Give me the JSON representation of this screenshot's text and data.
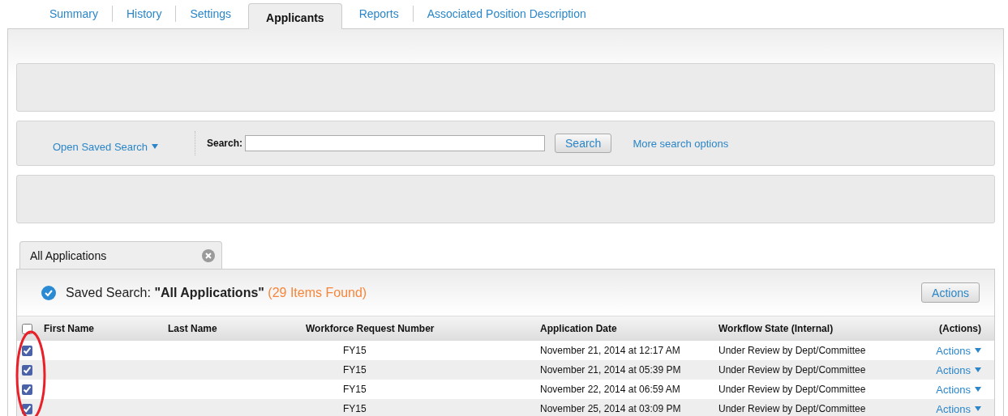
{
  "tabs": [
    {
      "label": "Summary",
      "selected": false
    },
    {
      "label": "History",
      "selected": false
    },
    {
      "label": "Settings",
      "selected": false
    },
    {
      "label": "Applicants",
      "selected": true
    },
    {
      "label": "Reports",
      "selected": false
    },
    {
      "label": "Associated Position Description",
      "selected": false
    }
  ],
  "search_bar": {
    "saved_search_link": "Open Saved Search",
    "label": "Search:",
    "search_button": "Search",
    "more_link": "More search options"
  },
  "results_tab": {
    "label": "All Applications"
  },
  "results": {
    "prefix": "Saved Search:",
    "name": "\"All Applications\"",
    "count": "(29 Items Found)",
    "actions_button": "Actions",
    "select_all_checked": false
  },
  "table": {
    "columns": [
      "First Name",
      "Last Name",
      "Workforce Request Number",
      "Application Date",
      "Workflow State (Internal)",
      "(Actions)"
    ],
    "rows": [
      {
        "checked": true,
        "request": "FY15",
        "date": "November 21, 2014 at 12:17 AM",
        "state": "Under Review by Dept/Committee",
        "action": "Actions"
      },
      {
        "checked": true,
        "request": "FY15",
        "date": "November 21, 2014 at 05:39 PM",
        "state": "Under Review by Dept/Committee",
        "action": "Actions"
      },
      {
        "checked": true,
        "request": "FY15",
        "date": "November 22, 2014 at 06:59 AM",
        "state": "Under Review by Dept/Committee",
        "action": "Actions"
      },
      {
        "checked": true,
        "request": "FY15",
        "date": "November 25, 2014 at 03:09 PM",
        "state": "Under Review by Dept/Committee",
        "action": "Actions"
      }
    ]
  }
}
